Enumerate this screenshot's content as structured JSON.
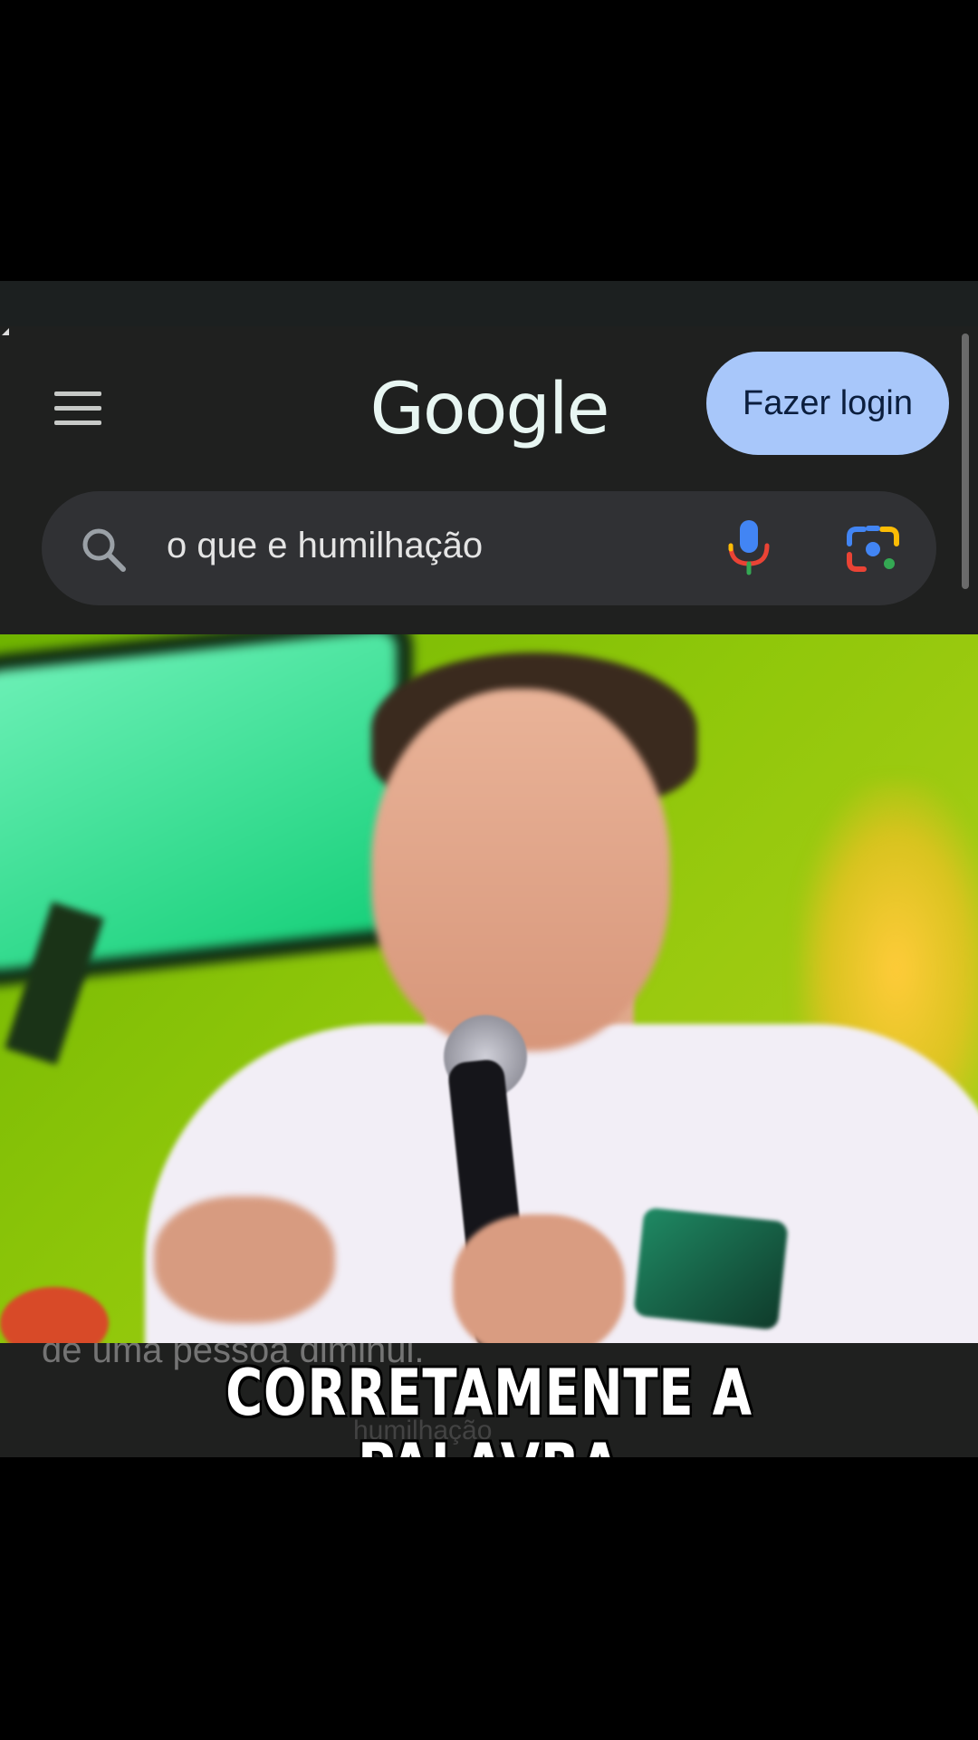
{
  "header": {
    "logo_text": "Google",
    "login_label": "Fazer login"
  },
  "search": {
    "query": "o que e humilhação"
  },
  "video": {
    "subtitle_ghost": "de uma pessoa diminui.",
    "subtitle_ghost2": "humilhação",
    "caption": "CORRETAMENTE A PALAVRA"
  },
  "colors": {
    "login_button_bg": "#a8c7fa",
    "search_bar_bg": "#303134",
    "page_bg": "#1f201f"
  },
  "icons": [
    "menu-icon",
    "search-icon",
    "microphone-icon",
    "google-lens-icon"
  ]
}
